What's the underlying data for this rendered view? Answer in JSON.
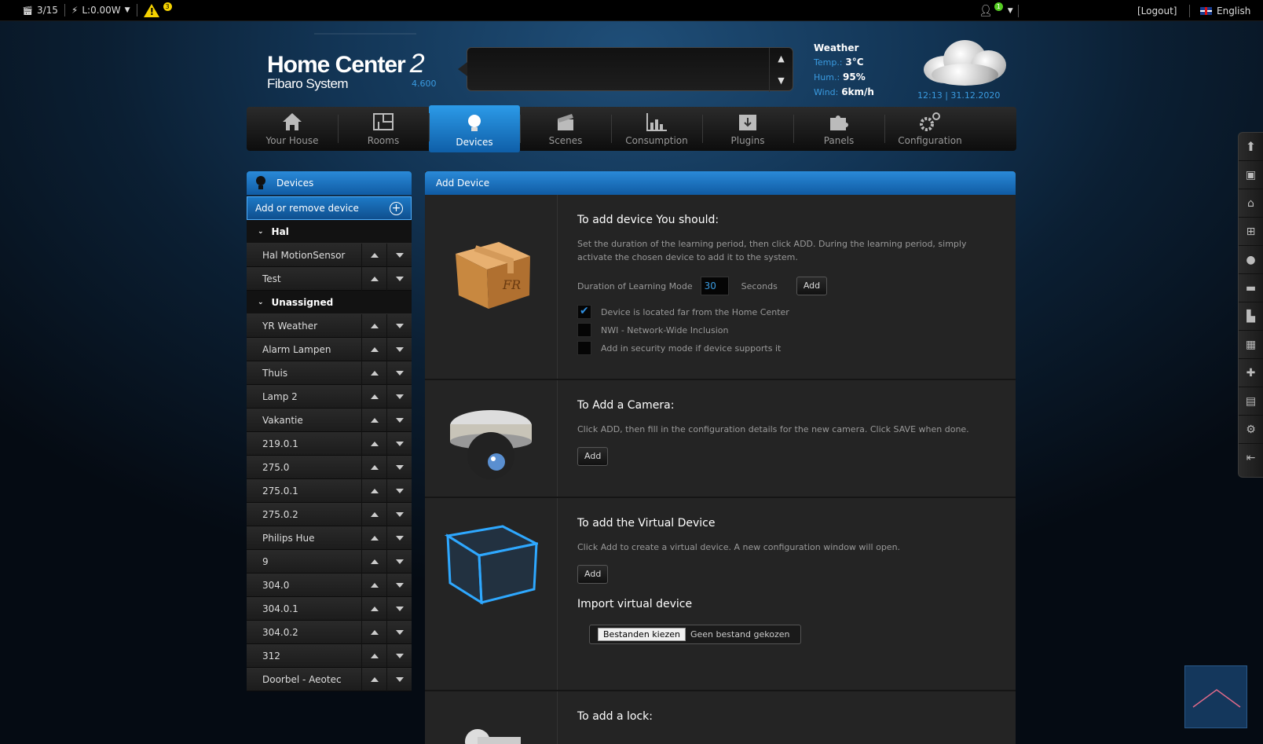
{
  "topbar": {
    "scenes_count": "3/15",
    "power": "L:0.00W",
    "warning_count": "3",
    "user_count": "1",
    "logout": "[Logout]",
    "language": "English"
  },
  "header": {
    "logo_title": "Home Center",
    "logo_number": "2",
    "logo_sub": "Fibaro System",
    "version": "4.600",
    "weather": {
      "title": "Weather",
      "temp_label": "Temp.:",
      "temp_value": "3°C",
      "hum_label": "Hum.:",
      "hum_value": "95%",
      "wind_label": "Wind:",
      "wind_value": "6km/h"
    },
    "clock": "12:13 | 31.12.2020"
  },
  "nav": [
    {
      "label": "Your House",
      "icon": "house-icon"
    },
    {
      "label": "Rooms",
      "icon": "rooms-icon"
    },
    {
      "label": "Devices",
      "icon": "bulb-icon",
      "active": true
    },
    {
      "label": "Scenes",
      "icon": "clapper-icon"
    },
    {
      "label": "Consumption",
      "icon": "chart-icon"
    },
    {
      "label": "Plugins",
      "icon": "plugin-box-icon"
    },
    {
      "label": "Panels",
      "icon": "puzzle-icon"
    },
    {
      "label": "Configuration",
      "icon": "gears-icon"
    }
  ],
  "sidebar": {
    "title": "Devices",
    "add_label": "Add or remove device",
    "groups": [
      {
        "name": "Hal",
        "items": [
          "Hal MotionSensor",
          "Test"
        ]
      },
      {
        "name": "Unassigned",
        "items": [
          "YR Weather",
          "Alarm Lampen",
          "Thuis",
          "Lamp 2",
          "Vakantie",
          "219.0.1",
          "275.0",
          "275.0.1",
          "275.0.2",
          "Philips Hue",
          "9",
          "304.0",
          "304.0.1",
          "304.0.2",
          "312",
          "Doorbel - Aeotec"
        ]
      }
    ]
  },
  "main": {
    "title": "Add Device",
    "device": {
      "title": "To add device You should:",
      "text": "Set the duration of the learning period, then click ADD. During the learning period, simply activate the chosen device to add it to the system.",
      "duration_label": "Duration of Learning Mode",
      "duration_value": "30",
      "seconds_label": "Seconds",
      "add_label": "Add",
      "options": [
        {
          "label": "Device is located far from the Home Center",
          "checked": true
        },
        {
          "label": "NWI - Network-Wide Inclusion",
          "checked": false
        },
        {
          "label": "Add in security mode if device supports it",
          "checked": false
        }
      ]
    },
    "camera": {
      "title": "To Add a Camera:",
      "text": "Click ADD, then fill in the configuration details for the new camera. Click SAVE when done.",
      "add_label": "Add"
    },
    "virtual": {
      "title": "To add the Virtual Device",
      "text": "Click Add to create a virtual device. A new configuration window will open.",
      "add_label": "Add",
      "import_title": "Import virtual device",
      "file_button": "Bestanden kiezen",
      "file_status": "Geen bestand gekozen"
    },
    "lock": {
      "title": "To add a lock:"
    }
  },
  "colors": {
    "accent": "#2a8ad8",
    "link": "#3a9be0",
    "warning": "#f5d200"
  }
}
